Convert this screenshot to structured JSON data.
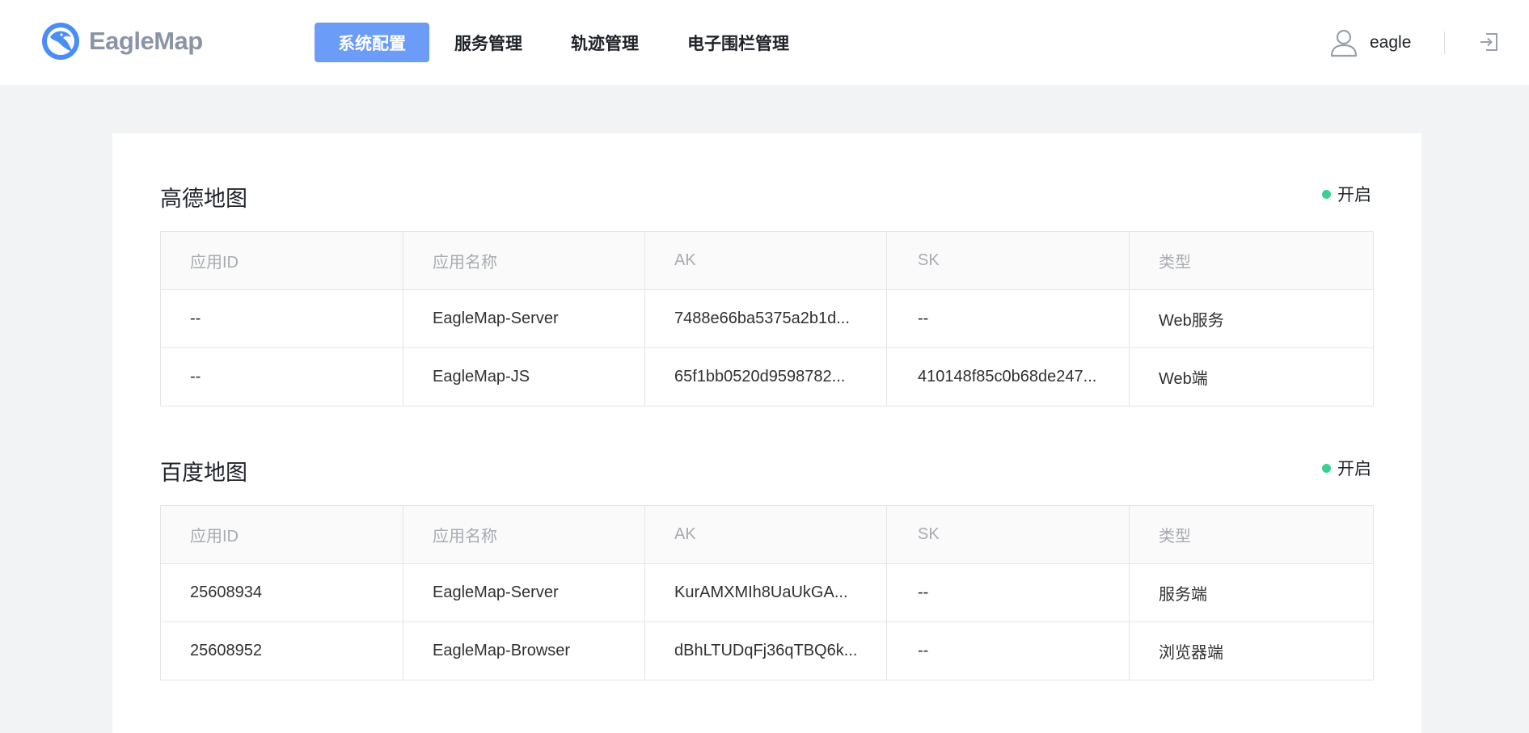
{
  "app": {
    "logo_text": "EagleMap",
    "brand_color": "#4a8ef5"
  },
  "nav": {
    "items": [
      {
        "label": "系统配置",
        "active": true
      },
      {
        "label": "服务管理",
        "active": false
      },
      {
        "label": "轨迹管理",
        "active": false
      },
      {
        "label": "电子围栏管理",
        "active": false
      }
    ],
    "active_color": "#6b9df8"
  },
  "user": {
    "icon": "user-icon",
    "name": "eagle",
    "logout_icon": "logout-icon"
  },
  "sections": [
    {
      "title": "高德地图",
      "status_label": "开启",
      "status_color": "#3ccf8e",
      "columns": [
        "应用ID",
        "应用名称",
        "AK",
        "SK",
        "类型"
      ],
      "rows": [
        [
          "--",
          "EagleMap-Server",
          "7488e66ba5375a2b1d...",
          "--",
          "Web服务"
        ],
        [
          "--",
          "EagleMap-JS",
          "65f1bb0520d9598782...",
          "410148f85c0b68de247...",
          "Web端"
        ]
      ]
    },
    {
      "title": "百度地图",
      "status_label": "开启",
      "status_color": "#3ccf8e",
      "columns": [
        "应用ID",
        "应用名称",
        "AK",
        "SK",
        "类型"
      ],
      "rows": [
        [
          "25608934",
          "EagleMap-Server",
          "KurAMXMIh8UaUkGA...",
          "--",
          "服务端"
        ],
        [
          "25608952",
          "EagleMap-Browser",
          "dBhLTUDqFj36qTBQ6k...",
          "--",
          "浏览器端"
        ]
      ]
    }
  ]
}
